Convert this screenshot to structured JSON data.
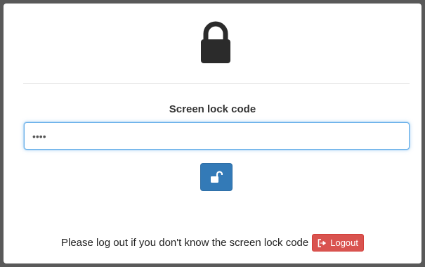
{
  "lock_screen": {
    "icon": "lock-icon",
    "label": "Screen lock code",
    "code_input": {
      "value": "••••",
      "placeholder": ""
    },
    "unlock_button": {
      "icon": "unlock-icon"
    },
    "footer": {
      "text": "Please log out if you don't know the screen lock code",
      "logout_label": "Logout",
      "logout_icon": "sign-out-icon"
    }
  },
  "colors": {
    "primary": "#337ab7",
    "danger": "#d9534f",
    "focus": "#66afe9",
    "icon": "#2b2b2b"
  }
}
